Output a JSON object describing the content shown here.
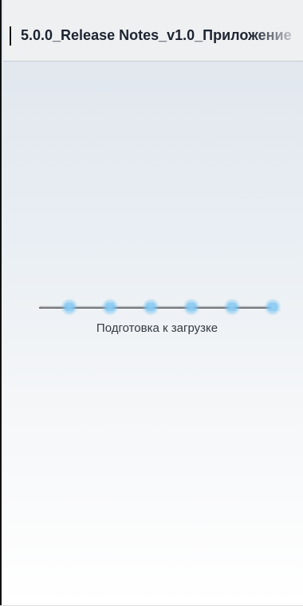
{
  "header": {
    "title": "5.0.0_Release Notes_v1.0_Приложение"
  },
  "loader": {
    "status_text": "Подготовка к загрузке",
    "dot_count": 6,
    "accent_color": "#7cc4f0",
    "track_color": "#555555"
  }
}
